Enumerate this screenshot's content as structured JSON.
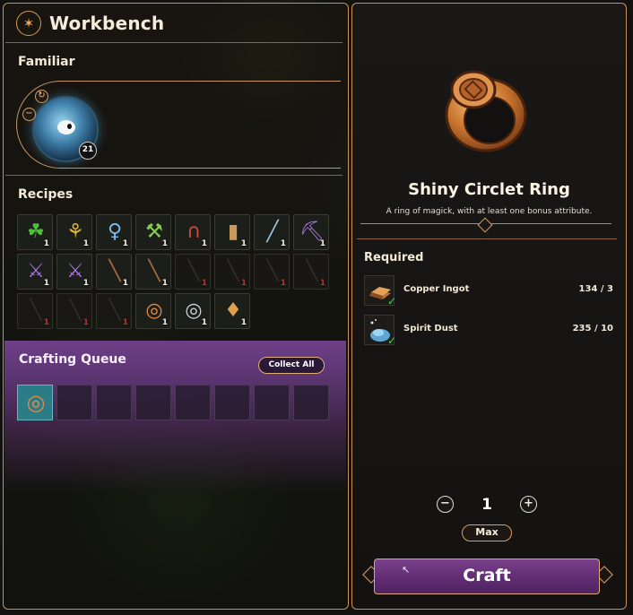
{
  "header": {
    "title": "Workbench",
    "icon": "flame-emblem-icon"
  },
  "familiar": {
    "label": "Familiar",
    "level": "21",
    "swap_icon": "swap-arrows-icon",
    "remove_icon": "minus-icon"
  },
  "recipes": {
    "label": "Recipes",
    "slots": [
      {
        "icon": "leaf-icon",
        "count": "1",
        "locked": false
      },
      {
        "icon": "plant-pot-icon",
        "count": "1",
        "locked": false
      },
      {
        "icon": "blue-fish-icon",
        "count": "1",
        "locked": false
      },
      {
        "icon": "green-sickle-icon",
        "count": "1",
        "locked": false
      },
      {
        "icon": "red-horseshoe-icon",
        "count": "1",
        "locked": false
      },
      {
        "icon": "wood-planks-icon",
        "count": "1",
        "locked": false
      },
      {
        "icon": "fishing-rod-icon",
        "count": "1",
        "locked": false
      },
      {
        "icon": "purple-pickaxe-icon",
        "count": "1",
        "locked": false
      },
      {
        "icon": "purple-axe-icon",
        "count": "1",
        "locked": false
      },
      {
        "icon": "purple-axe-icon",
        "count": "1",
        "locked": false
      },
      {
        "icon": "wooden-stick-icon",
        "count": "1",
        "locked": false
      },
      {
        "icon": "wooden-stick-icon",
        "count": "1",
        "locked": false
      },
      {
        "icon": "locked-item-icon",
        "count": "1",
        "locked": true
      },
      {
        "icon": "locked-item-icon",
        "count": "1",
        "locked": true
      },
      {
        "icon": "locked-item-icon",
        "count": "1",
        "locked": true
      },
      {
        "icon": "locked-item-icon",
        "count": "1",
        "locked": true
      },
      {
        "icon": "locked-item-icon",
        "count": "1",
        "locked": true
      },
      {
        "icon": "locked-item-icon",
        "count": "1",
        "locked": true
      },
      {
        "icon": "locked-item-icon",
        "count": "1",
        "locked": true
      },
      {
        "icon": "copper-ring-icon",
        "count": "1",
        "locked": false
      },
      {
        "icon": "silver-ring-icon",
        "count": "1",
        "locked": false
      },
      {
        "icon": "amulet-icon",
        "count": "1",
        "locked": false
      }
    ]
  },
  "queue": {
    "label": "Crafting Queue",
    "collect_label": "Collect All",
    "slots": [
      {
        "icon": "copper-ring-icon",
        "filled": true
      },
      {
        "filled": false
      },
      {
        "filled": false
      },
      {
        "filled": false
      },
      {
        "filled": false
      },
      {
        "filled": false
      },
      {
        "filled": false
      },
      {
        "filled": false
      }
    ]
  },
  "item": {
    "name": "Shiny Circlet Ring",
    "description": "A ring of magick, with at least one bonus attribute.",
    "image_icon": "copper-ring-icon",
    "required_label": "Required",
    "requirements": [
      {
        "icon": "copper-ingot-icon",
        "name": "Copper Ingot",
        "quantity": "134 / 3",
        "met": true
      },
      {
        "icon": "spirit-dust-icon",
        "name": "Spirit Dust",
        "quantity": "235 / 10",
        "met": true
      }
    ]
  },
  "controls": {
    "minus_label": "−",
    "plus_label": "+",
    "quantity": "1",
    "max_label": "Max",
    "craft_label": "Craft"
  },
  "colors": {
    "accent_gold": "#c8915a",
    "craft_purple": "#6a3379",
    "queue_purple": "#6e3f88",
    "check_green": "#4bcc62",
    "locked_count_red": "#d94a3e"
  }
}
